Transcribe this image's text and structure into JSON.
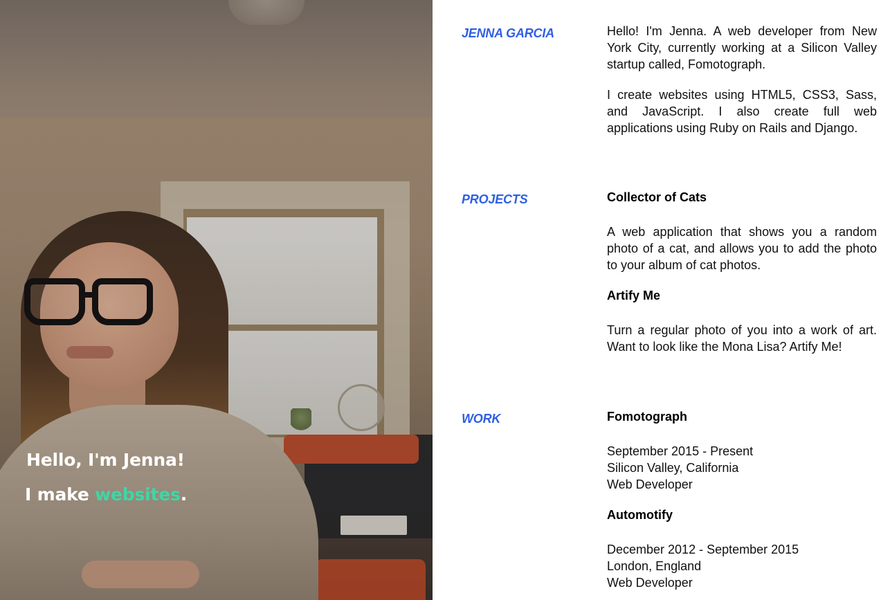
{
  "hero": {
    "greeting": "Hello, I'm Jenna!",
    "tagline_prefix": "I make ",
    "tagline_accent": "websites",
    "tagline_suffix": ".",
    "accent_color": "#3fd6a6"
  },
  "about": {
    "label": "JENNA GARCIA",
    "paragraphs": [
      "Hello! I'm Jenna. A web developer from New York City, currently working at a Silicon Valley startup called, Fomotograph.",
      "I create websites using HTML5, CSS3, Sass, and JavaScript. I also create full web applications using Ruby on Rails and Django."
    ]
  },
  "projects": {
    "label": "PROJECTS",
    "items": [
      {
        "title": "Collector of Cats",
        "description": "A web application that shows you a random photo of a cat, and allows you to add the photo to your album of cat photos."
      },
      {
        "title": "Artify Me",
        "description": "Turn a regular photo of you into a work of art. Want to look like the Mona Lisa? Artify Me!"
      }
    ]
  },
  "work": {
    "label": "WORK",
    "items": [
      {
        "company": "Fomotograph",
        "dates": "September 2015 - Present",
        "location": "Silicon Valley, California",
        "role": "Web Developer"
      },
      {
        "company": "Automotify",
        "dates": "December 2012 - September 2015",
        "location": "London, England",
        "role": "Web Developer"
      }
    ]
  },
  "colors": {
    "section_label": "#2f5fe3",
    "body_text": "#111111",
    "background": "#ffffff"
  }
}
